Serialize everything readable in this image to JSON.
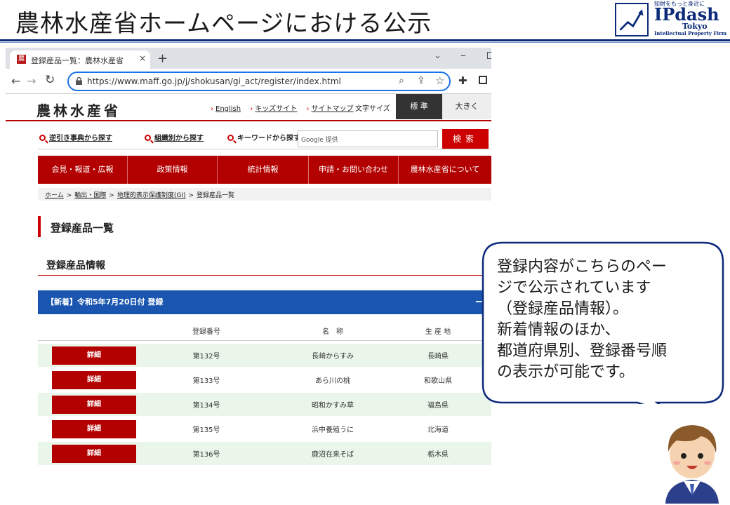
{
  "slide": {
    "title": "農林水産省ホームページにおける公示"
  },
  "logo": {
    "tagline": "知財をもっと身近に",
    "name": "IPdash",
    "city": "Tokyo",
    "firm": "Intellectual Property Firm"
  },
  "browser": {
    "tab_title": "登録産品一覧：農林水産省",
    "tab_close": "×",
    "new_tab": "+",
    "url": "https://www.maff.go.jp/j/shokusan/gi_act/register/index.html"
  },
  "site": {
    "logo_text": "農林水産省",
    "util_links": [
      "English",
      "キッズサイト",
      "サイトマップ"
    ],
    "font_size_label": "文字サイズ",
    "font_standard": "標 準",
    "font_large": "大きく",
    "search_tabs": [
      "逆引き事典から探す",
      "組織別から探す",
      "キーワードから探す"
    ],
    "search_placeholder": "Google 提供",
    "search_button": "検索",
    "gnav": [
      "会見・報道・広報",
      "政策情報",
      "統計情報",
      "申請・お問い合わせ",
      "農林水産省について"
    ],
    "breadcrumb": [
      "ホーム",
      "輸出・国際",
      "地理的表示保護制度(GI)",
      "登録産品一覧"
    ],
    "page_heading": "登録産品一覧",
    "section_heading": "登録産品情報",
    "accordion_title": "【新着】令和5年7月20日付 登録",
    "accordion_toggle": "－",
    "table": {
      "headers": [
        "登録番号",
        "名　称",
        "生 産 地"
      ],
      "detail_label": "詳細",
      "rows": [
        [
          "第132号",
          "長崎からすみ",
          "長崎県"
        ],
        [
          "第133号",
          "あら川の桃",
          "和歌山県"
        ],
        [
          "第134号",
          "昭和かすみ草",
          "福島県"
        ],
        [
          "第135号",
          "浜中養殖うに",
          "北海道"
        ],
        [
          "第136号",
          "鹿沼在来そば",
          "栃木県"
        ]
      ]
    }
  },
  "callout": {
    "lines": [
      "登録内容がこちらのペー",
      "ジで公示されています",
      "（登録産品情報）。",
      "新着情報のほか、",
      "都道府県別、登録番号順",
      "の表示が可能です。"
    ]
  },
  "colors": {
    "maff_red": "#b30000",
    "accordion_blue": "#1a56b0",
    "row_alt": "#eaf6ea",
    "slide_navy": "#0c2a7a"
  }
}
